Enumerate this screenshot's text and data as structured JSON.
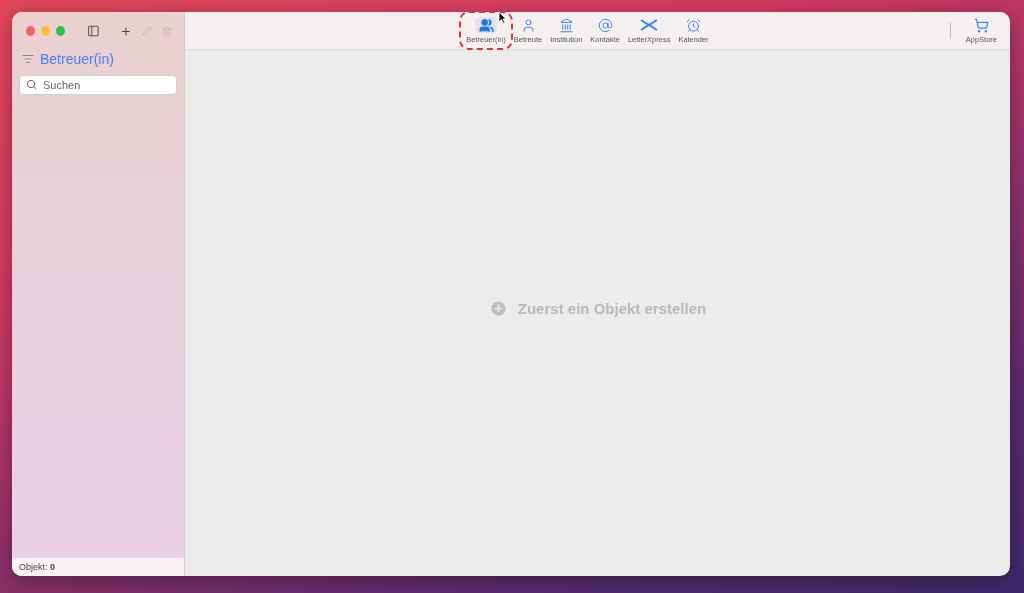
{
  "sidebar": {
    "title": "Betreuer(in)",
    "search": {
      "placeholder": "Suchen"
    },
    "status": "Objekt: **0**"
  },
  "toolbar": {
    "items": [
      {
        "label": "Betreuer(in)",
        "kind": "people",
        "selected": true
      },
      {
        "label": "Betreute",
        "kind": "person",
        "selected": false
      },
      {
        "label": "Institution",
        "kind": "bank",
        "selected": false
      },
      {
        "label": "Kontakte",
        "kind": "at",
        "selected": false
      },
      {
        "label": "LetterXpress",
        "kind": "cross",
        "selected": false
      },
      {
        "label": "Kalender",
        "kind": "alarm",
        "selected": false
      }
    ],
    "store": {
      "label": "AppStore"
    }
  },
  "empty_message": "Zuerst ein Objekt erstellen"
}
